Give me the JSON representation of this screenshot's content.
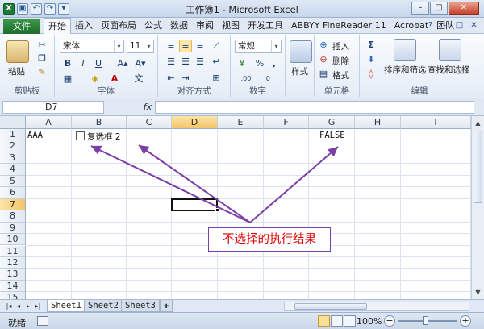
{
  "window": {
    "title": "工作簿1 - Microsoft Excel",
    "min_glyph": "–",
    "max_glyph": "□",
    "close_glyph": "✕"
  },
  "qat": {
    "app_glyph": "X",
    "save_glyph": "▣",
    "undo_glyph": "↶",
    "redo_glyph": "↷",
    "customize_glyph": "▾"
  },
  "menu": {
    "file_label": "文件",
    "tabs": [
      "开始",
      "插入",
      "页面布局",
      "公式",
      "数据",
      "审阅",
      "视图",
      "开发工具",
      "ABBYY FineReader 11",
      "Acrobat",
      "团队"
    ],
    "active_tab_index": 0,
    "right_glyphs": [
      "▵",
      "?",
      "–",
      "□",
      "✕"
    ]
  },
  "ribbon": {
    "clipboard": {
      "paste_label": "粘贴",
      "group_label": "剪贴板"
    },
    "font": {
      "font_name": "宋体",
      "font_size": "11",
      "bold": "B",
      "italic": "I",
      "underline": "U",
      "grow": "A▴",
      "shrink": "A▾",
      "group_label": "字体"
    },
    "alignment": {
      "group_label": "对齐方式"
    },
    "number": {
      "format": "常规",
      "percent": "%",
      "comma": ",",
      "group_label": "数字"
    },
    "styles": {
      "label": "样式"
    },
    "cells": {
      "insert": "插入",
      "delete": "删除",
      "format": "格式",
      "group_label": "单元格"
    },
    "editing": {
      "sigma": "Σ",
      "sort_filter": "排序和筛选",
      "find_select": "查找和选择",
      "group_label": "编辑"
    }
  },
  "formula_bar": {
    "name_box": "D7",
    "fx": "fx",
    "formula": ""
  },
  "grid": {
    "columns": [
      "A",
      "B",
      "C",
      "D",
      "E",
      "F",
      "G",
      "H",
      "I"
    ],
    "rows": [
      "1",
      "2",
      "3",
      "4",
      "5",
      "6",
      "7",
      "8",
      "9",
      "10",
      "11",
      "12",
      "13",
      "14",
      "15"
    ],
    "selected_column": "D",
    "selected_row": "7",
    "cells": {
      "A1": "AAA",
      "B1_checkbox_label": "复选框 2",
      "G1": "FALSE"
    }
  },
  "annotation": {
    "text": "不选择的执行结果",
    "border_color": "#7b3fa6",
    "text_color": "#e00000",
    "arrow_color": "#7b3fa6"
  },
  "sheets": {
    "tabs": [
      "Sheet1",
      "Sheet2",
      "Sheet3"
    ],
    "active_index": 0,
    "nav": [
      "|◂",
      "◂",
      "▸",
      "▸|"
    ]
  },
  "statusbar": {
    "status": "就绪",
    "zoom": "100%",
    "zoom_minus": "−",
    "zoom_plus": "+"
  },
  "colors": {
    "file_button": "#1d6c2b",
    "selected_header": "#f3c46a"
  }
}
